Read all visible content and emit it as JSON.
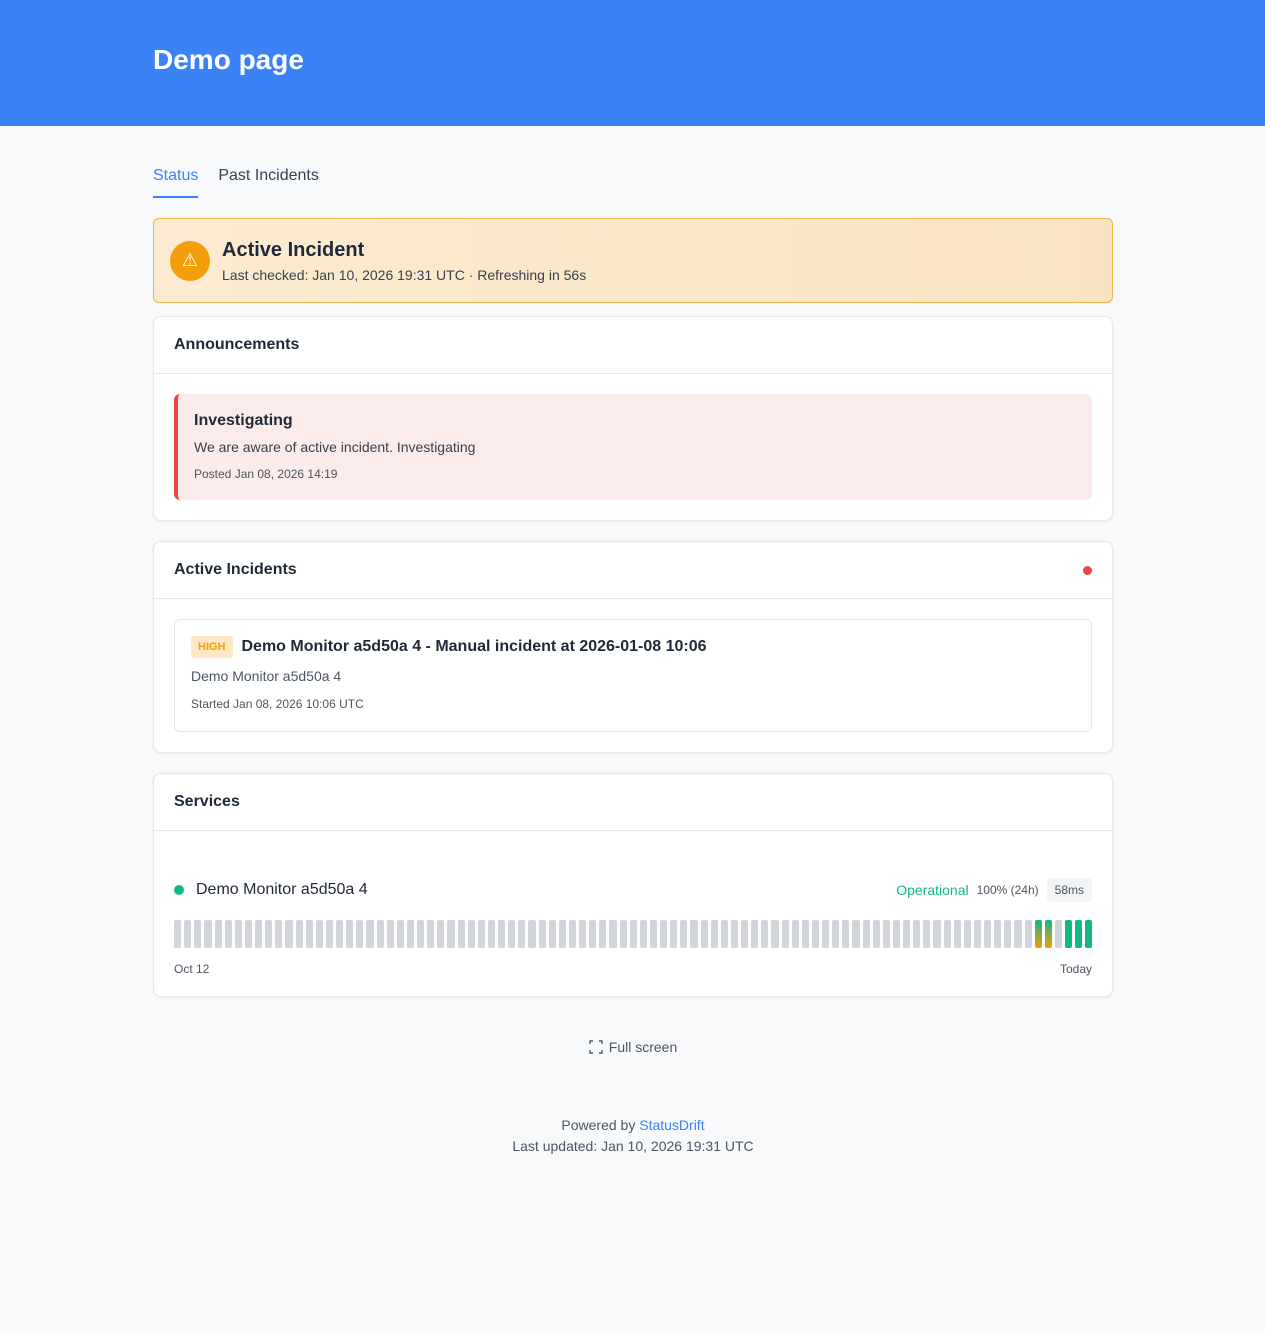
{
  "header": {
    "title": "Demo page"
  },
  "tabs": [
    {
      "label": "Status"
    },
    {
      "label": "Past Incidents"
    }
  ],
  "alert": {
    "icon": "warning-icon",
    "title": "Active Incident",
    "subtitle": "Last checked: Jan 10, 2026 19:31 UTC · Refreshing in 56s"
  },
  "announcements": {
    "heading": "Announcements",
    "items": [
      {
        "title": "Investigating",
        "text": "We are aware of active incident. Investigating",
        "posted": "Posted Jan 08, 2026 14:19"
      }
    ]
  },
  "active_incidents": {
    "heading": "Active Incidents",
    "items": [
      {
        "severity": "HIGH",
        "title": "Demo Monitor a5d50a 4 - Manual incident at 2026-01-08 10:06",
        "monitor": "Demo Monitor a5d50a 4",
        "started": "Started Jan 08, 2026 10:06 UTC"
      }
    ]
  },
  "services": {
    "heading": "Services",
    "items": [
      {
        "name": "Demo Monitor a5d50a 4",
        "status": "Operational",
        "uptime": "100% (24h)",
        "latency": "58ms",
        "history_start": "Oct 12",
        "history_end": "Today",
        "history": [
          "none",
          "none",
          "none",
          "none",
          "none",
          "none",
          "none",
          "none",
          "none",
          "none",
          "none",
          "none",
          "none",
          "none",
          "none",
          "none",
          "none",
          "none",
          "none",
          "none",
          "none",
          "none",
          "none",
          "none",
          "none",
          "none",
          "none",
          "none",
          "none",
          "none",
          "none",
          "none",
          "none",
          "none",
          "none",
          "none",
          "none",
          "none",
          "none",
          "none",
          "none",
          "none",
          "none",
          "none",
          "none",
          "none",
          "none",
          "none",
          "none",
          "none",
          "none",
          "none",
          "none",
          "none",
          "none",
          "none",
          "none",
          "none",
          "none",
          "none",
          "none",
          "none",
          "none",
          "none",
          "none",
          "none",
          "none",
          "none",
          "none",
          "none",
          "none",
          "none",
          "none",
          "none",
          "none",
          "none",
          "none",
          "none",
          "none",
          "none",
          "none",
          "none",
          "none",
          "none",
          "none",
          "mixed",
          "mixed",
          "none",
          "up",
          "up",
          "up"
        ]
      }
    ]
  },
  "fullscreen": {
    "label": "Full screen"
  },
  "footer": {
    "powered_prefix": "Powered by",
    "brand": "StatusDrift",
    "last_updated": "Last updated: Jan 10, 2026 19:31 UTC"
  },
  "colors": {
    "accent": "#3b82f6",
    "warning": "#f59e0b",
    "danger": "#ef4444",
    "success": "#10b981",
    "no_data": "#d1d5db"
  }
}
